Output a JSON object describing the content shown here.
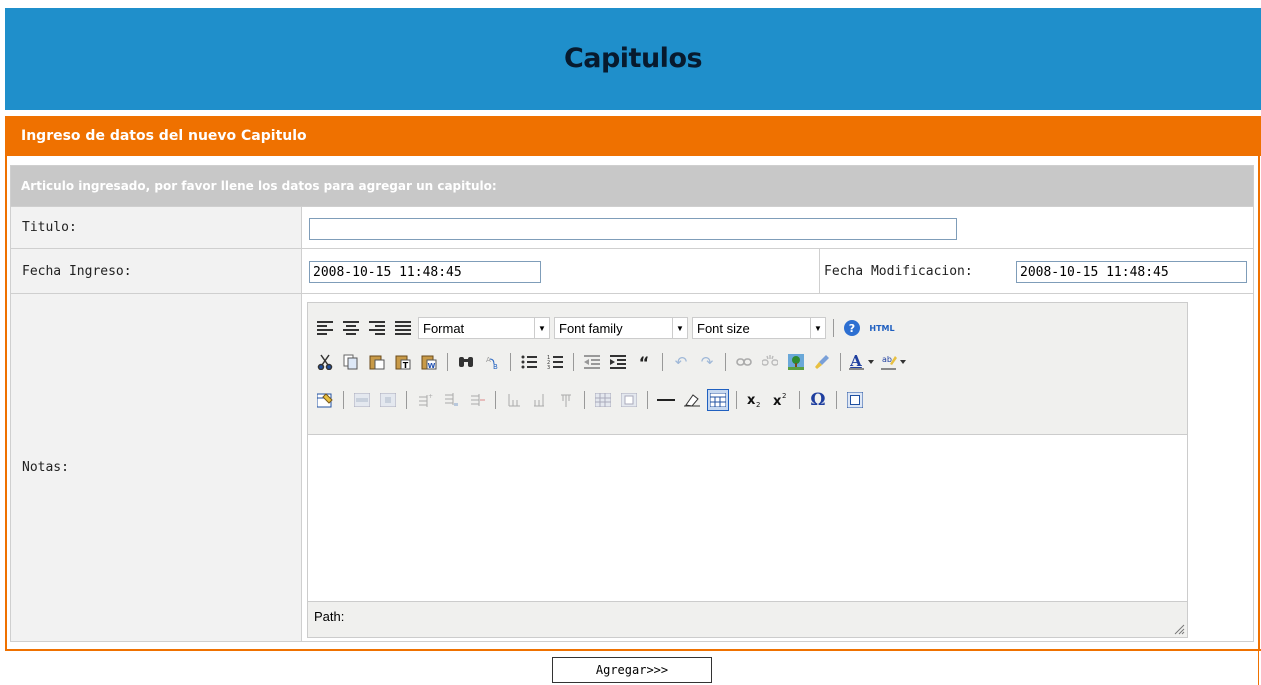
{
  "page": {
    "title": "Capitulos"
  },
  "section": {
    "title": "Ingreso de datos del nuevo Capitulo"
  },
  "form": {
    "message": "Articulo ingresado, por favor llene los datos para agregar un capitulo:",
    "titulo_label": "Titulo:",
    "titulo_value": "",
    "fecha_ingreso_label": "Fecha Ingreso:",
    "fecha_ingreso_value": "2008-10-15 11:48:45",
    "fecha_mod_label": "Fecha Modificacion:",
    "fecha_mod_value": "2008-10-15 11:48:45",
    "notas_label": "Notas:"
  },
  "editor": {
    "format_label": "Format",
    "font_family_label": "Font family",
    "font_size_label": "Font size",
    "html_label": "HTML",
    "path_label": "Path:",
    "row1_icons": [
      "align-left-icon",
      "align-center-icon",
      "align-right-icon",
      "align-justify-icon",
      "help-icon",
      "html-source-icon"
    ],
    "row2_icons": [
      "cut-icon",
      "copy-icon",
      "paste-icon",
      "paste-text-icon",
      "paste-word-icon",
      "find-icon",
      "replace-icon",
      "bullet-list-icon",
      "numbered-list-icon",
      "outdent-icon",
      "indent-icon",
      "blockquote-icon",
      "undo-icon",
      "redo-icon",
      "link-icon",
      "unlink-icon",
      "image-icon",
      "cleanup-icon",
      "text-color-icon",
      "highlight-color-icon"
    ],
    "row3_icons": [
      "edit-table-icon",
      "row-props-icon",
      "cell-props-icon",
      "insert-row-before-icon",
      "insert-row-after-icon",
      "delete-row-icon",
      "insert-col-before-icon",
      "insert-col-after-icon",
      "delete-col-icon",
      "split-cells-icon",
      "merge-cells-icon",
      "hr-icon",
      "remove-format-icon",
      "visual-aid-icon",
      "subscript-icon",
      "superscript-icon",
      "char-map-icon",
      "fullscreen-icon"
    ]
  },
  "submit": {
    "label": "Agregar>>>"
  },
  "colors": {
    "header": "#1f8fcb",
    "section": "#ef7100",
    "message_bar": "#c8c8c8"
  }
}
